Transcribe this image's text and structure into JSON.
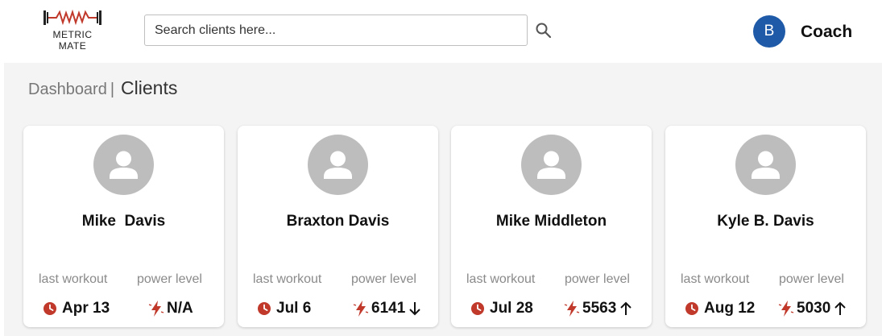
{
  "app": {
    "logo_line1": "METRIC",
    "logo_line2": "MATE"
  },
  "search": {
    "placeholder": "Search clients here..."
  },
  "user": {
    "initial": "B",
    "role": "Coach"
  },
  "breadcrumb": {
    "parent": "Dashboard",
    "separator": "|",
    "current": "Clients"
  },
  "colors": {
    "accent_red": "#c0392b",
    "avatar_blue": "#1e5aa8",
    "placeholder_gray": "#bdbdbd"
  },
  "labels": {
    "last_workout": "last workout",
    "power_level": "power level"
  },
  "clients": [
    {
      "name": "Mike  Davis",
      "last_workout": "Apr 13",
      "power_level": "N/A",
      "trend": "none"
    },
    {
      "name": "Braxton Davis",
      "last_workout": "Jul 6",
      "power_level": "6141",
      "trend": "down"
    },
    {
      "name": "Mike Middleton",
      "last_workout": "Jul 28",
      "power_level": "5563",
      "trend": "up"
    },
    {
      "name": "Kyle B. Davis",
      "last_workout": "Aug 12",
      "power_level": "5030",
      "trend": "up"
    }
  ],
  "icons": {
    "search": "search-icon",
    "clock": "clock-icon",
    "bolt": "lightning-icon",
    "trend_up": "arrow-up-icon",
    "trend_down": "arrow-down-icon"
  }
}
